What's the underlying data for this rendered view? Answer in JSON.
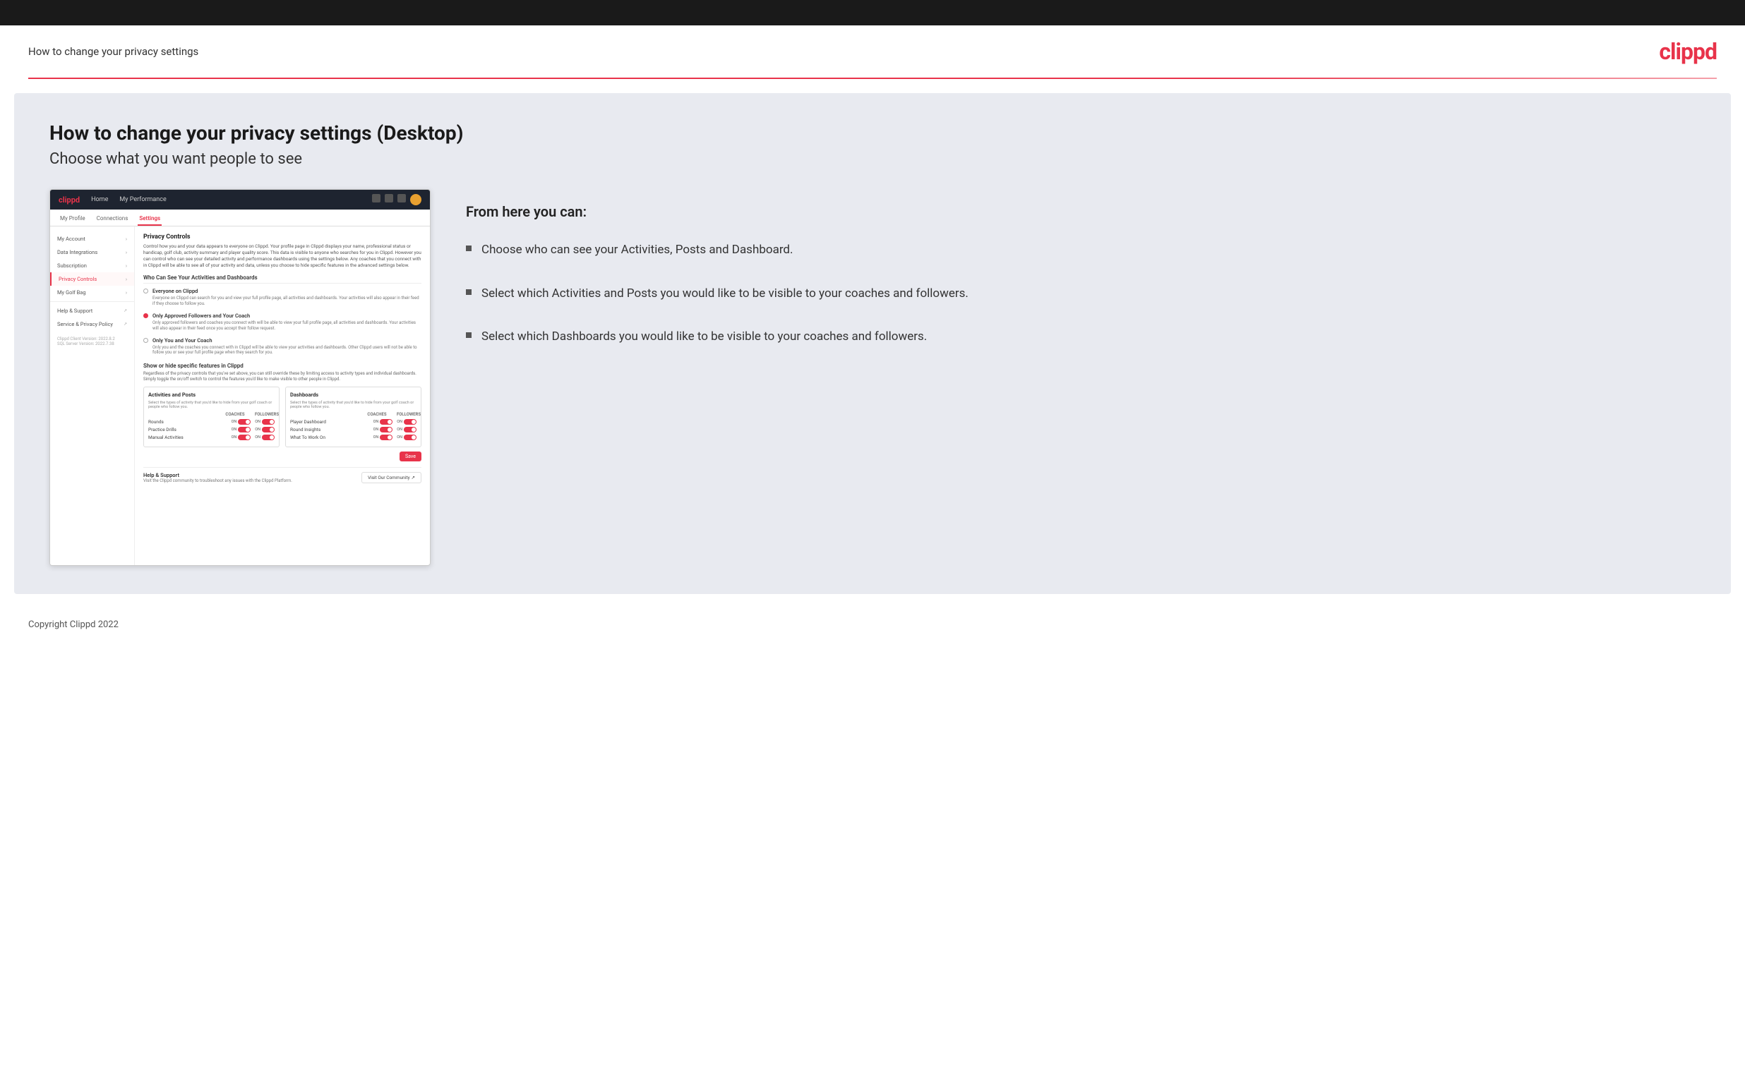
{
  "header": {
    "title": "How to change your privacy settings",
    "logo": "clippd"
  },
  "main": {
    "heading": "How to change your privacy settings (Desktop)",
    "subheading": "Choose what you want people to see",
    "mockup": {
      "nav": {
        "logo": "clippd",
        "items": [
          "Home",
          "My Performance"
        ]
      },
      "tabs": [
        "My Profile",
        "Connections",
        "Settings"
      ],
      "active_tab": "Settings",
      "sidebar": {
        "items": [
          {
            "label": "My Account",
            "active": false,
            "chevron": true
          },
          {
            "label": "Data Integrations",
            "active": false,
            "chevron": true
          },
          {
            "label": "Subscription",
            "active": false,
            "chevron": true
          },
          {
            "label": "Privacy Controls",
            "active": true,
            "chevron": true
          },
          {
            "label": "My Golf Bag",
            "active": false,
            "chevron": true
          },
          {
            "label": "Help & Support",
            "active": false,
            "ext": true
          },
          {
            "label": "Service & Privacy Policy",
            "active": false,
            "ext": true
          }
        ],
        "version": "Clippd Client Version: 2022.8.2\nSQL Server Version: 2022.7.38"
      },
      "main": {
        "section_title": "Privacy Controls",
        "section_desc": "Control how you and your data appears to everyone on Clippd. Your profile page in Clippd displays your name, professional status or handicap, golf club, activity summary and player quality score. This data is visible to anyone who searches for you in Clippd. However you can control who can see your detailed activity and performance dashboards using the settings below. Any coaches that you connect with in Clippd will be able to see all of your activity and data, unless you choose to hide specific features in the advanced settings below.",
        "subsection_title": "Who Can See Your Activities and Dashboards",
        "radio_options": [
          {
            "label": "Everyone on Clippd",
            "desc": "Everyone on Clippd can search for you and view your full profile page, all activities and dashboards. Your activities will also appear in their feed if they choose to follow you.",
            "selected": false
          },
          {
            "label": "Only Approved Followers and Your Coach",
            "desc": "Only approved followers and coaches you connect with will be able to view your full profile page, all activities and dashboards. Your activities will also appear in their feed once you accept their follow request.",
            "selected": true
          },
          {
            "label": "Only You and Your Coach",
            "desc": "Only you and the coaches you connect with in Clippd will be able to view your activities and dashboards. Other Clippd users will not be able to follow you or see your full profile page when they search for you.",
            "selected": false
          }
        ],
        "toggle_section_title": "Show or hide specific features in Clippd",
        "toggle_section_desc": "Regardless of the privacy controls that you've set above, you can still override these by limiting access to activity types and individual dashboards. Simply toggle the on/off switch to control the features you'd like to make visible to other people in Clippd.",
        "activities_col": {
          "title": "Activities and Posts",
          "desc": "Select the types of activity that you'd like to hide from your golf coach or people who follow you.",
          "headers": [
            "COACHES",
            "FOLLOWERS"
          ],
          "rows": [
            {
              "label": "Rounds",
              "coaches_on": true,
              "followers_on": true
            },
            {
              "label": "Practice Drills",
              "coaches_on": true,
              "followers_on": true
            },
            {
              "label": "Manual Activities",
              "coaches_on": true,
              "followers_on": true
            }
          ]
        },
        "dashboards_col": {
          "title": "Dashboards",
          "desc": "Select the types of activity that you'd like to hide from your golf coach or people who follow you.",
          "headers": [
            "COACHES",
            "FOLLOWERS"
          ],
          "rows": [
            {
              "label": "Player Dashboard",
              "coaches_on": true,
              "followers_on": true
            },
            {
              "label": "Round Insights",
              "coaches_on": true,
              "followers_on": true
            },
            {
              "label": "What To Work On",
              "coaches_on": true,
              "followers_on": true
            }
          ]
        },
        "save_label": "Save",
        "help": {
          "title": "Help & Support",
          "desc": "Visit the Clippd community to troubleshoot any issues with the Clippd Platform.",
          "btn": "Visit Our Community"
        }
      }
    },
    "right": {
      "heading": "From here you can:",
      "bullets": [
        "Choose who can see your Activities, Posts and Dashboard.",
        "Select which Activities and Posts you would like to be visible to your coaches and followers.",
        "Select which Dashboards you would like to be visible to your coaches and followers."
      ]
    }
  },
  "footer": {
    "text": "Copyright Clippd 2022"
  }
}
